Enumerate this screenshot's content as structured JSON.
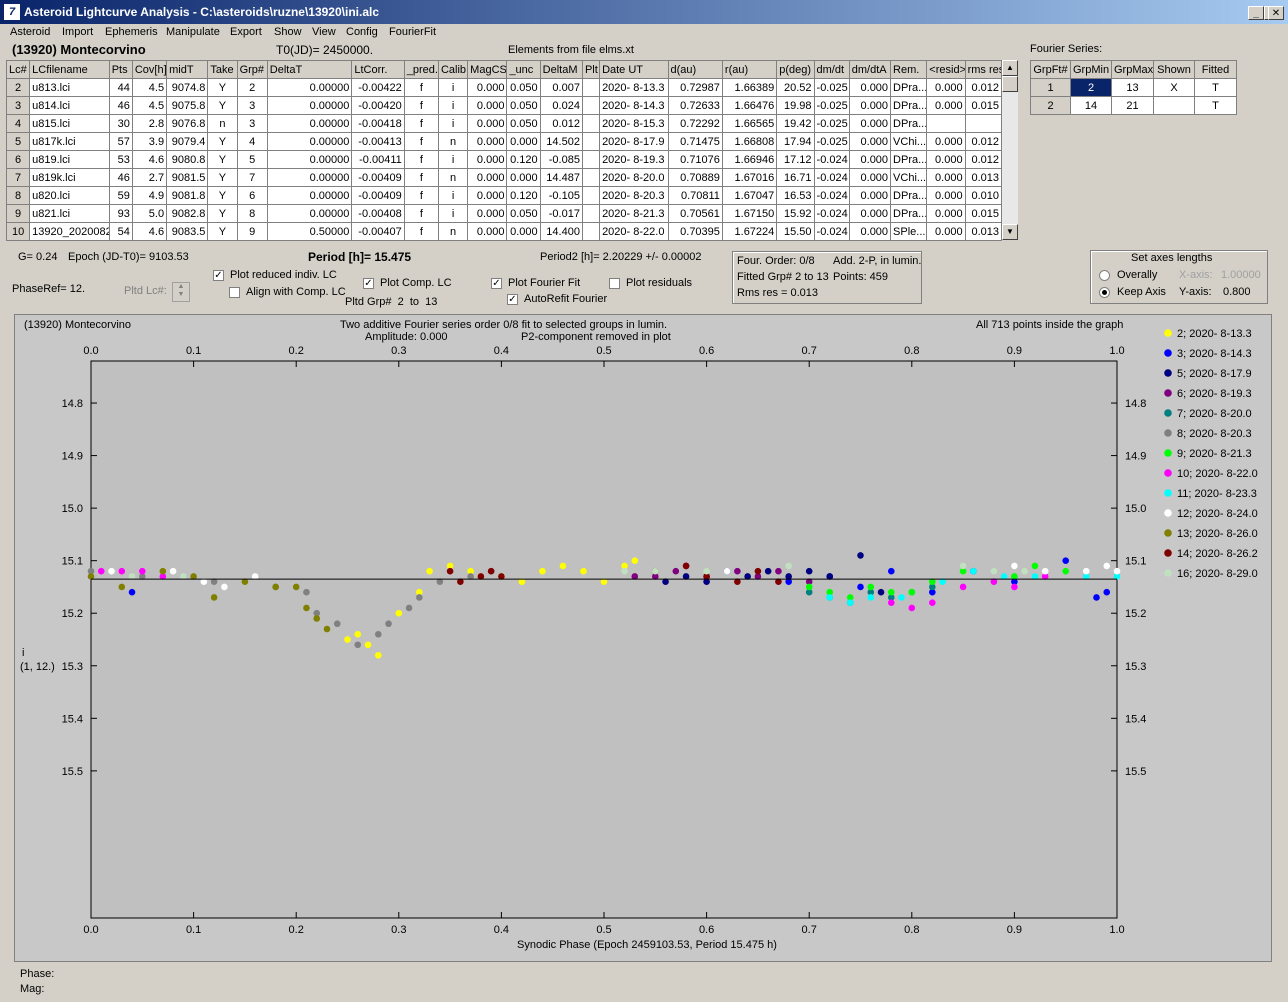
{
  "window": {
    "title": "Asteroid Lightcurve Analysis - C:\\asteroids\\ruzne\\13920\\ini.alc"
  },
  "menu": [
    "Asteroid",
    "Import",
    "Ephemeris",
    "Manipulate",
    "Export",
    "Show",
    "View",
    "Config",
    "FourierFit"
  ],
  "header": {
    "asteroid_name": "(13920) Montecorvino",
    "t0": "T0(JD)= 2450000.",
    "elements": "Elements from file elms.xt"
  },
  "lc_table": {
    "columns": [
      "Lc#",
      "LCfilename",
      "Pts",
      "Cov[h]",
      "midT",
      "Take",
      "Grp#",
      "DeltaT",
      "LtCorr.",
      "_pred.",
      "Calib",
      "MagCS",
      "_unc",
      "DeltaM",
      "Plt",
      "Date UT",
      "d(au)",
      "r(au)",
      "p(deg)",
      "dm/dt",
      "dm/dtA",
      "Rem.",
      "<resid>",
      "rms res"
    ],
    "rows": [
      [
        "2",
        "u813.lci",
        "44",
        "4.5",
        "9074.8",
        "Y",
        "2",
        "0.00000",
        "-0.00422",
        "f",
        "i",
        "0.000",
        "0.050",
        "0.007",
        "",
        "2020- 8-13.3",
        "0.72987",
        "1.66389",
        "20.52",
        "-0.025",
        "0.000",
        "DPra...",
        "0.000",
        "0.012"
      ],
      [
        "3",
        "u814.lci",
        "46",
        "4.5",
        "9075.8",
        "Y",
        "3",
        "0.00000",
        "-0.00420",
        "f",
        "i",
        "0.000",
        "0.050",
        "0.024",
        "",
        "2020- 8-14.3",
        "0.72633",
        "1.66476",
        "19.98",
        "-0.025",
        "0.000",
        "DPra...",
        "0.000",
        "0.015"
      ],
      [
        "4",
        "u815.lci",
        "30",
        "2.8",
        "9076.8",
        "n",
        "3",
        "0.00000",
        "-0.00418",
        "f",
        "i",
        "0.000",
        "0.050",
        "0.012",
        "",
        "2020- 8-15.3",
        "0.72292",
        "1.66565",
        "19.42",
        "-0.025",
        "0.000",
        "DPra...",
        "",
        ""
      ],
      [
        "5",
        "u817k.lci",
        "57",
        "3.9",
        "9079.4",
        "Y",
        "4",
        "0.00000",
        "-0.00413",
        "f",
        "n",
        "0.000",
        "0.000",
        "14.502",
        "",
        "2020- 8-17.9",
        "0.71475",
        "1.66808",
        "17.94",
        "-0.025",
        "0.000",
        "VChi...",
        "0.000",
        "0.012"
      ],
      [
        "6",
        "u819.lci",
        "53",
        "4.6",
        "9080.8",
        "Y",
        "5",
        "0.00000",
        "-0.00411",
        "f",
        "i",
        "0.000",
        "0.120",
        "-0.085",
        "",
        "2020- 8-19.3",
        "0.71076",
        "1.66946",
        "17.12",
        "-0.024",
        "0.000",
        "DPra...",
        "0.000",
        "0.012"
      ],
      [
        "7",
        "u819k.lci",
        "46",
        "2.7",
        "9081.5",
        "Y",
        "7",
        "0.00000",
        "-0.00409",
        "f",
        "n",
        "0.000",
        "0.000",
        "14.487",
        "",
        "2020- 8-20.0",
        "0.70889",
        "1.67016",
        "16.71",
        "-0.024",
        "0.000",
        "VChi...",
        "0.000",
        "0.013"
      ],
      [
        "8",
        "u820.lci",
        "59",
        "4.9",
        "9081.8",
        "Y",
        "6",
        "0.00000",
        "-0.00409",
        "f",
        "i",
        "0.000",
        "0.120",
        "-0.105",
        "",
        "2020- 8-20.3",
        "0.70811",
        "1.67047",
        "16.53",
        "-0.024",
        "0.000",
        "DPra...",
        "0.000",
        "0.010"
      ],
      [
        "9",
        "u821.lci",
        "93",
        "5.0",
        "9082.8",
        "Y",
        "8",
        "0.00000",
        "-0.00408",
        "f",
        "i",
        "0.000",
        "0.050",
        "-0.017",
        "",
        "2020- 8-21.3",
        "0.70561",
        "1.67150",
        "15.92",
        "-0.024",
        "0.000",
        "DPra...",
        "0.000",
        "0.015"
      ],
      [
        "10",
        "13920_2020082",
        "54",
        "4.6",
        "9083.5",
        "Y",
        "9",
        "0.50000",
        "-0.00407",
        "f",
        "n",
        "0.000",
        "0.000",
        "14.400",
        "",
        "2020- 8-22.0",
        "0.70395",
        "1.67224",
        "15.50",
        "-0.024",
        "0.000",
        "SPle...",
        "0.000",
        "0.013"
      ]
    ]
  },
  "fourier_series": {
    "title": "Fourier Series:",
    "columns": [
      "GrpFt#",
      "GrpMin",
      "GrpMax",
      "Shown",
      "Fitted"
    ],
    "rows": [
      [
        "1",
        "2",
        "13",
        "X",
        "T"
      ],
      [
        "2",
        "14",
        "21",
        "",
        "T"
      ]
    ]
  },
  "params": {
    "g": "G= 0.24",
    "epoch": "Epoch (JD-T0)= 9103.53",
    "period": "Period [h]= 15.475",
    "period2": "Period2 [h]= 2.20229 +/- 0.00002",
    "phaseref": "PhaseRef= 12.",
    "pltd_lc": "Pltd Lc#:",
    "pltd_grp_label": "Pltd Grp#",
    "pltd_grp_from": "2",
    "pltd_grp_to_label": "to",
    "pltd_grp_to": "13"
  },
  "checkboxes": {
    "plot_reduced": {
      "label": "Plot reduced indiv. LC",
      "checked": true
    },
    "align_comp": {
      "label": "Align with Comp. LC",
      "checked": false
    },
    "plot_comp": {
      "label": "Plot Comp. LC",
      "checked": true
    },
    "plot_fourier": {
      "label": "Plot Fourier Fit",
      "checked": true
    },
    "plot_residuals": {
      "label": "Plot residuals",
      "checked": false
    },
    "autorefit": {
      "label": "AutoRefit Fourier",
      "checked": true
    }
  },
  "fit_info": {
    "order": "Four. Order:  0/8",
    "add": "Add. 2-P, in lumin.",
    "fitted": "Fitted Grp# 2 to 13",
    "points": "Points: 459",
    "rms": "Rms res     = 0.013"
  },
  "axes_lengths": {
    "title": "Set axes lengths",
    "overally": "Overally",
    "keep_axis": "Keep Axis",
    "x_axis_label": "X-axis:",
    "x_axis_value": "1.00000",
    "y_axis_label": "Y-axis:",
    "y_axis_value": "0.800"
  },
  "plot": {
    "object": "(13920) Montecorvino",
    "subtitle1": "Two additive Fourier series order 0/8 fit to selected groups in lumin.",
    "subtitle2_amp": "Amplitude: 0.000",
    "subtitle2_p2": "P2-component removed in plot",
    "inside": "All 713 points inside the graph",
    "ylabel1": "i",
    "ylabel2": "(1, 12.)"
  },
  "status": {
    "phase": "Phase:",
    "mag": "Mag:"
  },
  "chart_data": {
    "type": "scatter",
    "xlabel": "Synodic Phase (Epoch 2459103.53, Period 15.475 h)",
    "ylabel": "i (1, 12.)",
    "xlim": [
      0.0,
      1.0
    ],
    "ylim": [
      15.78,
      14.72
    ],
    "x_ticks": [
      "0.0",
      "0.1",
      "0.2",
      "0.3",
      "0.4",
      "0.5",
      "0.6",
      "0.7",
      "0.8",
      "0.9",
      "1.0"
    ],
    "y_ticks": [
      "14.8",
      "14.9",
      "15.0",
      "15.1",
      "15.2",
      "15.3",
      "15.4",
      "15.5"
    ],
    "fit_line": 15.135,
    "series": [
      {
        "name": "2; 2020- 8-13.3",
        "color": "#ffff00",
        "points": [
          [
            0.26,
            15.24
          ],
          [
            0.27,
            15.26
          ],
          [
            0.25,
            15.25
          ],
          [
            0.28,
            15.28
          ],
          [
            0.3,
            15.2
          ],
          [
            0.32,
            15.16
          ],
          [
            0.33,
            15.12
          ],
          [
            0.35,
            15.11
          ],
          [
            0.37,
            15.12
          ],
          [
            0.38,
            15.13
          ],
          [
            0.4,
            15.13
          ],
          [
            0.42,
            15.14
          ],
          [
            0.44,
            15.12
          ],
          [
            0.46,
            15.11
          ],
          [
            0.48,
            15.12
          ],
          [
            0.5,
            15.14
          ],
          [
            0.52,
            15.11
          ],
          [
            0.53,
            15.1
          ]
        ]
      },
      {
        "name": "3; 2020- 8-14.3",
        "color": "#0000ff",
        "points": [
          [
            0.68,
            15.14
          ],
          [
            0.72,
            15.13
          ],
          [
            0.75,
            15.15
          ],
          [
            0.78,
            15.12
          ],
          [
            0.82,
            15.16
          ],
          [
            0.86,
            15.12
          ],
          [
            0.9,
            15.14
          ],
          [
            0.95,
            15.1
          ],
          [
            0.98,
            15.17
          ],
          [
            0.99,
            15.16
          ],
          [
            0.04,
            15.16
          ]
        ]
      },
      {
        "name": "5; 2020- 8-17.9",
        "color": "#000080",
        "points": [
          [
            0.56,
            15.14
          ],
          [
            0.58,
            15.13
          ],
          [
            0.6,
            15.14
          ],
          [
            0.62,
            15.12
          ],
          [
            0.64,
            15.13
          ],
          [
            0.66,
            15.12
          ],
          [
            0.68,
            15.13
          ],
          [
            0.7,
            15.12
          ],
          [
            0.72,
            15.13
          ],
          [
            0.75,
            15.09
          ],
          [
            0.77,
            15.16
          ]
        ]
      },
      {
        "name": "6; 2020- 8-19.3",
        "color": "#800080",
        "points": [
          [
            0.53,
            15.13
          ],
          [
            0.55,
            15.13
          ],
          [
            0.57,
            15.12
          ],
          [
            0.58,
            15.11
          ],
          [
            0.6,
            15.13
          ],
          [
            0.63,
            15.12
          ],
          [
            0.65,
            15.13
          ],
          [
            0.67,
            15.12
          ],
          [
            0.7,
            15.14
          ]
        ]
      },
      {
        "name": "7; 2020- 8-20.0",
        "color": "#008080",
        "points": [
          [
            0.7,
            15.16
          ],
          [
            0.72,
            15.17
          ],
          [
            0.74,
            15.18
          ],
          [
            0.76,
            15.16
          ],
          [
            0.78,
            15.17
          ],
          [
            0.8,
            15.16
          ],
          [
            0.82,
            15.15
          ]
        ]
      },
      {
        "name": "8; 2020- 8-20.3",
        "color": "#808080",
        "points": [
          [
            0.0,
            15.12
          ],
          [
            0.05,
            15.13
          ],
          [
            0.12,
            15.14
          ],
          [
            0.18,
            15.15
          ],
          [
            0.21,
            15.16
          ],
          [
            0.22,
            15.2
          ],
          [
            0.24,
            15.22
          ],
          [
            0.26,
            15.26
          ],
          [
            0.28,
            15.24
          ],
          [
            0.29,
            15.22
          ],
          [
            0.31,
            15.19
          ],
          [
            0.32,
            15.17
          ],
          [
            0.34,
            15.14
          ],
          [
            0.37,
            15.13
          ],
          [
            0.39,
            15.12
          ]
        ]
      },
      {
        "name": "9; 2020- 8-21.3",
        "color": "#00ff00",
        "points": [
          [
            0.7,
            15.15
          ],
          [
            0.72,
            15.16
          ],
          [
            0.74,
            15.17
          ],
          [
            0.76,
            15.15
          ],
          [
            0.78,
            15.16
          ],
          [
            0.8,
            15.16
          ],
          [
            0.82,
            15.14
          ],
          [
            0.85,
            15.12
          ],
          [
            0.88,
            15.14
          ],
          [
            0.9,
            15.13
          ],
          [
            0.92,
            15.11
          ],
          [
            0.95,
            15.12
          ]
        ]
      },
      {
        "name": "10; 2020- 8-22.0",
        "color": "#ff00ff",
        "points": [
          [
            0.01,
            15.12
          ],
          [
            0.03,
            15.12
          ],
          [
            0.05,
            15.12
          ],
          [
            0.07,
            15.13
          ],
          [
            0.78,
            15.18
          ],
          [
            0.8,
            15.19
          ],
          [
            0.82,
            15.18
          ],
          [
            0.85,
            15.15
          ],
          [
            0.88,
            15.14
          ],
          [
            0.9,
            15.15
          ],
          [
            0.93,
            15.13
          ]
        ]
      },
      {
        "name": "11; 2020- 8-23.3",
        "color": "#00ffff",
        "points": [
          [
            0.72,
            15.17
          ],
          [
            0.74,
            15.18
          ],
          [
            0.76,
            15.17
          ],
          [
            0.79,
            15.17
          ],
          [
            0.83,
            15.14
          ],
          [
            0.86,
            15.12
          ],
          [
            0.89,
            15.13
          ],
          [
            0.92,
            15.13
          ],
          [
            0.97,
            15.13
          ],
          [
            1.0,
            15.13
          ]
        ]
      },
      {
        "name": "12; 2020- 8-24.0",
        "color": "#ffffff",
        "points": [
          [
            0.02,
            15.12
          ],
          [
            0.08,
            15.12
          ],
          [
            0.11,
            15.14
          ],
          [
            0.13,
            15.15
          ],
          [
            0.16,
            15.13
          ],
          [
            0.62,
            15.12
          ],
          [
            0.9,
            15.11
          ],
          [
            0.93,
            15.12
          ],
          [
            0.97,
            15.12
          ],
          [
            0.99,
            15.11
          ],
          [
            1.0,
            15.12
          ]
        ]
      },
      {
        "name": "13; 2020- 8-26.0",
        "color": "#808000",
        "points": [
          [
            0.0,
            15.13
          ],
          [
            0.03,
            15.15
          ],
          [
            0.07,
            15.12
          ],
          [
            0.1,
            15.13
          ],
          [
            0.12,
            15.17
          ],
          [
            0.15,
            15.14
          ],
          [
            0.18,
            15.15
          ],
          [
            0.2,
            15.15
          ],
          [
            0.21,
            15.19
          ],
          [
            0.22,
            15.21
          ],
          [
            0.23,
            15.23
          ]
        ]
      },
      {
        "name": "14; 2020- 8-26.2",
        "color": "#800000",
        "points": [
          [
            0.35,
            15.12
          ],
          [
            0.36,
            15.14
          ],
          [
            0.38,
            15.13
          ],
          [
            0.39,
            15.12
          ],
          [
            0.4,
            15.13
          ],
          [
            0.55,
            15.12
          ],
          [
            0.58,
            15.11
          ],
          [
            0.6,
            15.13
          ],
          [
            0.63,
            15.14
          ],
          [
            0.65,
            15.12
          ],
          [
            0.67,
            15.14
          ]
        ]
      },
      {
        "name": "16; 2020- 8-29.0",
        "color": "#c0e0c0",
        "points": [
          [
            0.04,
            15.13
          ],
          [
            0.09,
            15.13
          ],
          [
            0.52,
            15.12
          ],
          [
            0.55,
            15.12
          ],
          [
            0.6,
            15.12
          ],
          [
            0.68,
            15.11
          ],
          [
            0.85,
            15.11
          ],
          [
            0.88,
            15.12
          ],
          [
            0.91,
            15.12
          ]
        ]
      }
    ]
  }
}
